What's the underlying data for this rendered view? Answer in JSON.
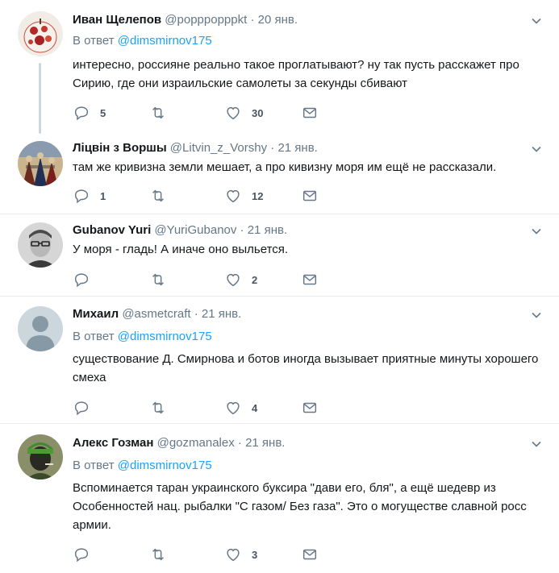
{
  "reply_prefix": "В ответ",
  "tweets": [
    {
      "name": "Иван Щелепов",
      "handle": "@popppopppkt",
      "date": "20 янв.",
      "reply_to": "@dimsmirnov175",
      "text": "интересно, россияне реально такое проглатывают? ну так пусть расскажет про Сирию, где они израильские самолеты за секунды сбивают",
      "replies": "5",
      "retweets": "",
      "likes": "30"
    },
    {
      "name": "Ліцвін з Воршы",
      "handle": "@Litvin_z_Vorshy",
      "date": "21 янв.",
      "text": "там же кривизна земли мешает, а про кивизну моря им ещё не рассказали.",
      "replies": "1",
      "retweets": "",
      "likes": "12"
    },
    {
      "name": "Gubanov Yuri",
      "handle": "@YuriGubanov",
      "date": "21 янв.",
      "text": "У моря  - гладь! А иначе оно выльется.",
      "replies": "",
      "retweets": "",
      "likes": "2"
    },
    {
      "name": "Михаил",
      "handle": "@asmetcraft",
      "date": "21 янв.",
      "reply_to": "@dimsmirnov175",
      "text": "существование Д. Смирнова и ботов иногда вызывает приятные минуты хорошего смеха",
      "replies": "",
      "retweets": "",
      "likes": "4"
    },
    {
      "name": "Алекс Гозман",
      "handle": "@gozmanalex",
      "date": "21 янв.",
      "reply_to": "@dimsmirnov175",
      "text": "Вспоминается таран украинского буксира \"дави его, бля\", а ещё шедевр из Особенностей нац. рыбалки \"С газом/ Без газа\". Это о могуществе славной росс армии.",
      "replies": "",
      "retweets": "",
      "likes": "3"
    }
  ],
  "colors": {
    "link": "#1da1f2",
    "secondary_text": "#657786",
    "divider": "#e6ecf0",
    "thread_line": "#ccd6dd"
  },
  "icons": [
    "reply-icon",
    "retweet-icon",
    "like-icon",
    "direct-message-icon",
    "chevron-down-icon"
  ]
}
